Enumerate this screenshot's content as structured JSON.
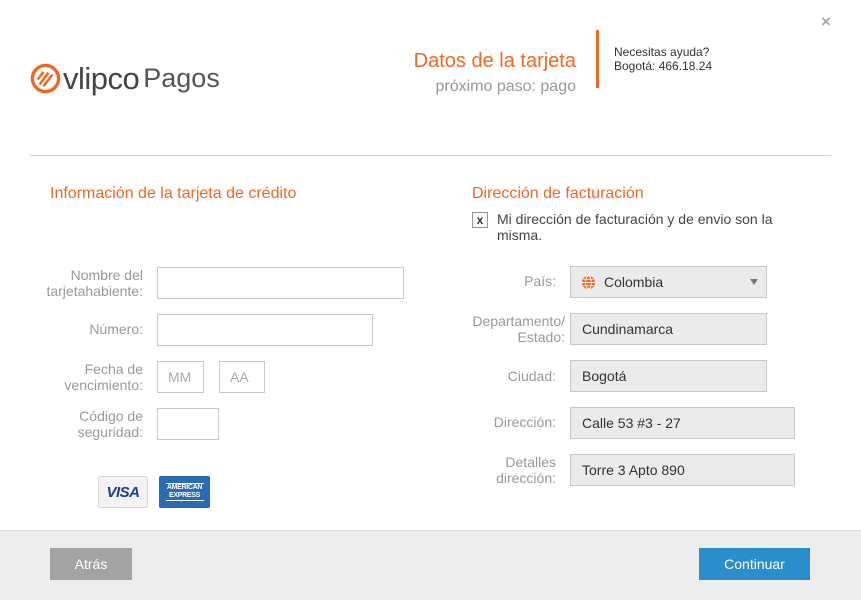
{
  "header": {
    "brand_name": "vlipco",
    "brand_sub": "Pagos",
    "step_title": "Datos de la tarjeta",
    "step_next": "próximo paso: pago",
    "help_line1": "Necesitas ayuda?",
    "help_line2": "Bogotá: 466.18.24",
    "close_label": "×"
  },
  "card_section": {
    "title": "Información de la tarjeta de crédito",
    "holder_label_1": "Nombre del",
    "holder_label_2": "tarjetahabiente:",
    "holder_value": "",
    "number_label": "Número:",
    "number_value": "",
    "expiry_label_1": "Fecha de",
    "expiry_label_2": "vencimiento:",
    "month_placeholder": "MM",
    "year_placeholder": "AA",
    "cvv_label_1": "Código de",
    "cvv_label_2": "seguridad:",
    "cvv_value": "",
    "visa_label": "VISA",
    "amex_line1": "AMERICAN",
    "amex_line2": "EXPRESS"
  },
  "billing_section": {
    "title": "Dirección de facturación",
    "same_checkbox_mark": "x",
    "same_checkbox_label": "Mi dirección de facturación y de envio son la misma.",
    "country_label": "País:",
    "country_value": "Colombia",
    "state_label_1": "Departamento/",
    "state_label_2": "Estado:",
    "state_value": "Cundinamarca",
    "city_label": "Ciudad:",
    "city_value": "Bogotá",
    "address_label": "Dirección:",
    "address_value": "Calle 53 #3 - 27",
    "details_label_1": "Detalles",
    "details_label_2": "dirección:",
    "details_value": "Torre 3 Apto 890"
  },
  "footer": {
    "back_label": "Atrás",
    "continue_label": "Continuar"
  },
  "colors": {
    "accent": "#f26722",
    "primary_button": "#2a8ecc",
    "secondary_button": "#a3a3a3"
  }
}
